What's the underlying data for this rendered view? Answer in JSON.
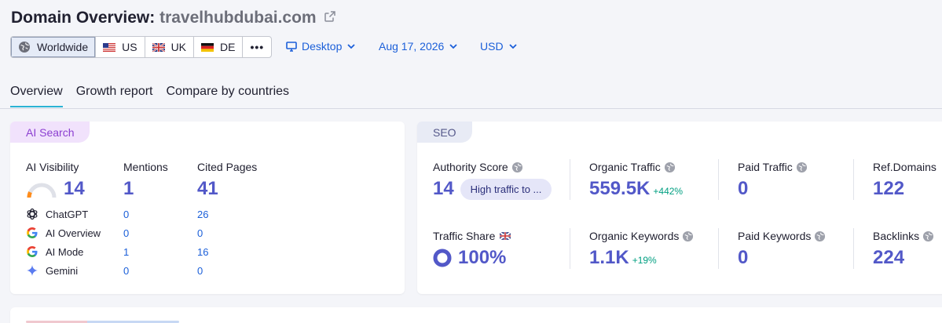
{
  "header": {
    "title_prefix": "Domain Overview:",
    "domain": "travelhubdubai.com"
  },
  "regions": [
    {
      "label": "Worldwide",
      "icon": "globe-icon",
      "active": true
    },
    {
      "label": "US",
      "icon": "us-flag-icon"
    },
    {
      "label": "UK",
      "icon": "uk-flag-icon"
    },
    {
      "label": "DE",
      "icon": "de-flag-icon"
    }
  ],
  "more_label": "•••",
  "filters": {
    "device": "Desktop",
    "date": "Aug 17, 2026",
    "currency": "USD"
  },
  "tabs": [
    {
      "label": "Overview",
      "active": true
    },
    {
      "label": "Growth report"
    },
    {
      "label": "Compare by countries"
    }
  ],
  "ai_search": {
    "pill": "AI Search",
    "col_visibility": "AI Visibility",
    "col_mentions": "Mentions",
    "col_cited": "Cited Pages",
    "visibility": "14",
    "visibility_level": 0.14,
    "mentions": "1",
    "cited": "41",
    "rows": [
      {
        "name": "ChatGPT",
        "icon": "chatgpt-icon",
        "mentions": "0",
        "cited": "26"
      },
      {
        "name": "AI Overview",
        "icon": "google-icon",
        "mentions": "0",
        "cited": "0"
      },
      {
        "name": "AI Mode",
        "icon": "google-icon",
        "mentions": "1",
        "cited": "16"
      },
      {
        "name": "Gemini",
        "icon": "gemini-icon",
        "mentions": "0",
        "cited": "0"
      }
    ]
  },
  "seo": {
    "pill": "SEO",
    "authority_label": "Authority Score",
    "authority_value": "14",
    "authority_badge": "High traffic to ...",
    "organic_traffic_label": "Organic Traffic",
    "organic_traffic_value": "559.5K",
    "organic_traffic_delta": "+442%",
    "paid_traffic_label": "Paid Traffic",
    "paid_traffic_value": "0",
    "ref_domains_label": "Ref.Domains",
    "ref_domains_value": "122",
    "traffic_share_label": "Traffic Share",
    "traffic_share_value": "100%",
    "traffic_share_level": 1.0,
    "organic_keywords_label": "Organic Keywords",
    "organic_keywords_value": "1.1K",
    "organic_keywords_delta": "+19%",
    "paid_keywords_label": "Paid Keywords",
    "paid_keywords_value": "0",
    "backlinks_label": "Backlinks",
    "backlinks_value": "224"
  },
  "colors": {
    "accent_blue": "#1b5fd9",
    "metric_purple": "#5258c8",
    "delta_green": "#009f81",
    "ai_pill": "#f1e2fc",
    "seo_pill": "#e8ebf5"
  }
}
